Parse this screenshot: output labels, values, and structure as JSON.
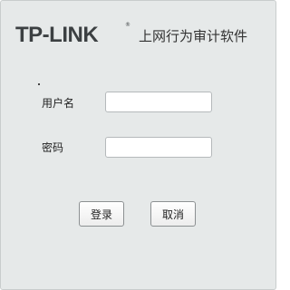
{
  "header": {
    "logo_text": "TP-LINK",
    "trademark": "®",
    "product_name": "上网行为审计软件"
  },
  "form": {
    "username_label": "用户名",
    "username_value": "",
    "password_label": "密码",
    "password_value": ""
  },
  "buttons": {
    "login_label": "登录",
    "cancel_label": "取消"
  }
}
